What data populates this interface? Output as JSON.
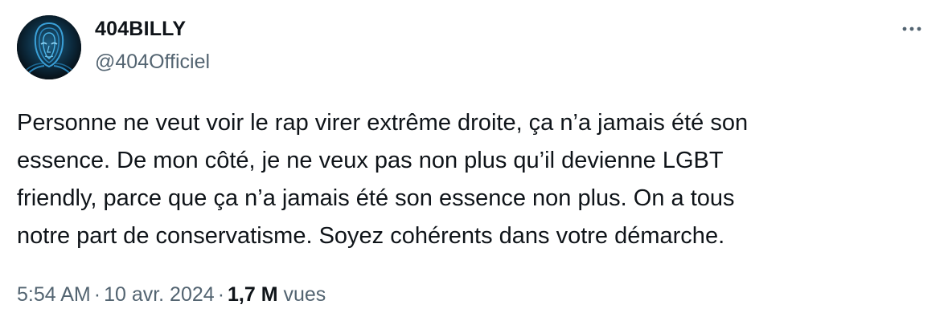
{
  "author": {
    "display_name": "404BILLY",
    "handle": "@404Officiel",
    "avatar_icon": "avatar-face-portrait-icon"
  },
  "more_icon": "more-horizontal-icon",
  "tweet": {
    "text": "Personne ne veut voir le rap virer extrême droite, ça n’a jamais été son\nessence. De mon côté, je ne veux pas non plus qu’il devienne LGBT\nfriendly, parce que ça n’a jamais été son essence non plus. On a tous\nnotre part de conservatisme. Soyez cohérents dans votre démarche."
  },
  "meta": {
    "time": "5:54 AM",
    "separator": "·",
    "date": "10 avr. 2024",
    "views_count": "1,7 M",
    "views_label": "vues"
  },
  "colors": {
    "text_primary": "#0f1419",
    "text_secondary": "#536471",
    "background": "#ffffff",
    "avatar_accent": "#3aa0d8"
  }
}
